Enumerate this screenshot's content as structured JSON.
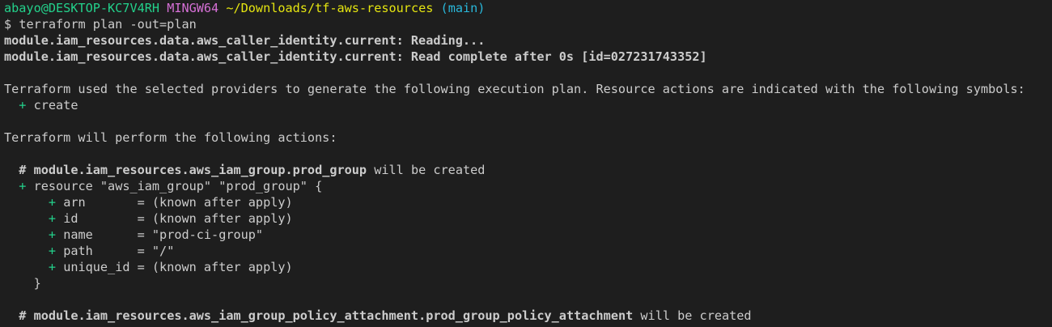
{
  "prompt": {
    "user_host": "abayo@DESKTOP-KC7V4RH",
    "shell": "MINGW64",
    "path": "~/Downloads/tf-aws-resources",
    "branch": "(main)",
    "symbol": "$",
    "command": "terraform plan -out=plan"
  },
  "output": {
    "reading": "module.iam_resources.data.aws_caller_identity.current: Reading...",
    "read_complete": "module.iam_resources.data.aws_caller_identity.current: Read complete after 0s [id=027231743352]",
    "intro": "Terraform used the selected providers to generate the following execution plan. Resource actions are indicated with the following symbols:",
    "create_symbol": "+",
    "create_label": "create",
    "perform": "Terraform will perform the following actions:",
    "resource1": {
      "comment_hash": "#",
      "address": "module.iam_resources.aws_iam_group.prod_group",
      "suffix": "will be created",
      "plus": "+",
      "declaration": "resource \"aws_iam_group\" \"prod_group\" {",
      "attributes": [
        {
          "plus": "+",
          "text": "arn       = (known after apply)"
        },
        {
          "plus": "+",
          "text": "id        = (known after apply)"
        },
        {
          "plus": "+",
          "text": "name      = \"prod-ci-group\""
        },
        {
          "plus": "+",
          "text": "path      = \"/\""
        },
        {
          "plus": "+",
          "text": "unique_id = (known after apply)"
        }
      ],
      "close": "}"
    },
    "resource2": {
      "comment_hash": "#",
      "address": "module.iam_resources.aws_iam_group_policy_attachment.prod_group_policy_attachment",
      "suffix": "will be created"
    }
  }
}
